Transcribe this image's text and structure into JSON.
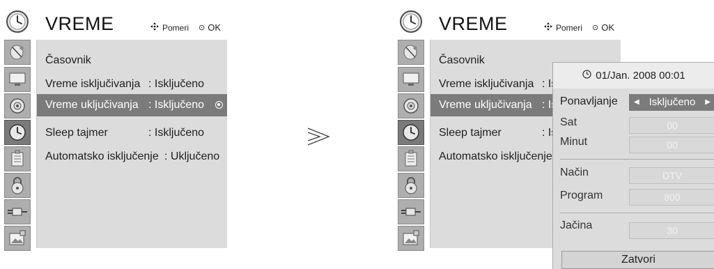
{
  "left_screen": {
    "title": "VREME",
    "nav_move_label": "Pomeri",
    "nav_ok_label": "OK",
    "menu": [
      {
        "label": "Časovnik",
        "value": ""
      },
      {
        "label": "Vreme isključivanja",
        "value": ": Isključeno"
      },
      {
        "label": "Vreme uključivanja",
        "value": ": Isključeno",
        "selected": true
      },
      {
        "label": "Sleep tajmer",
        "value": ": Isključeno"
      },
      {
        "label": "Automatsko isključenje",
        "value": ": Uključeno"
      }
    ]
  },
  "right_screen": {
    "title": "VREME",
    "nav_move_label": "Pomeri",
    "nav_ok_label": "OK",
    "menu": [
      {
        "label": "Časovnik",
        "value": ""
      },
      {
        "label": "Vreme isključivanja",
        "value": ": Is"
      },
      {
        "label": "Vreme uključivanja",
        "value": ": Is",
        "selected": true
      },
      {
        "label": "Sleep tajmer",
        "value": ": Is"
      },
      {
        "label": "Automatsko isključenje",
        "value": ""
      }
    ],
    "popup": {
      "datetime": "01/Jan. 2008 00:01",
      "repeat_label": "Ponavljanje",
      "repeat_value": "Isključeno",
      "hour_label": "Sat",
      "hour_value": "00",
      "minute_label": "Minut",
      "minute_value": "00",
      "mode_label": "Način",
      "mode_value": "DTV",
      "program_label": "Program",
      "program_value": "800",
      "volume_label": "Jačina",
      "volume_value": "30",
      "close_label": "Zatvori"
    }
  },
  "icons": [
    "clock-icon",
    "satellite-icon",
    "monitor-icon",
    "speaker-icon",
    "time-icon",
    "option-icon",
    "lock-icon",
    "input-plug-icon",
    "usb-photo-icon"
  ],
  "colors": {
    "menu_bg": "#dcdcdc",
    "selected_bg": "#7b7b7b",
    "icon_bg": "#aeaeae"
  }
}
